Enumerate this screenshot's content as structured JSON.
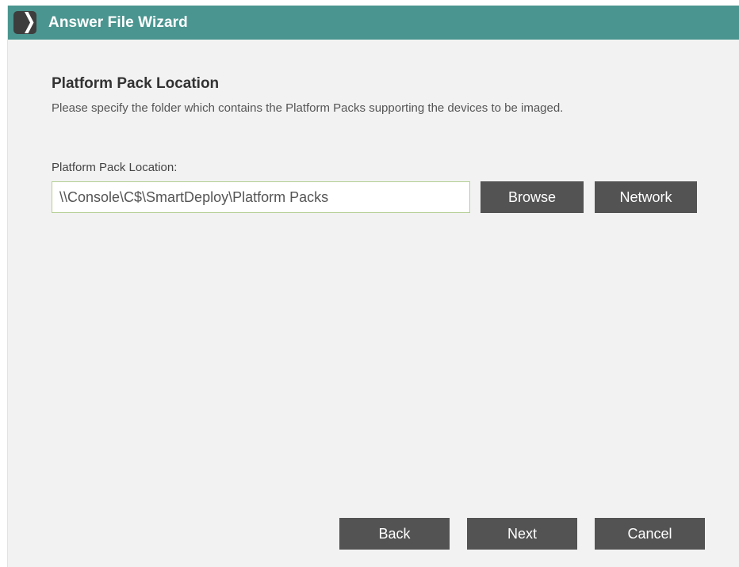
{
  "window": {
    "title": "Answer File Wizard",
    "logo_icon": "smartdeploy-chevron-icon",
    "accent_color": "#4a9590"
  },
  "section": {
    "title": "Platform Pack Location",
    "description": "Please specify the folder which contains the Platform Packs supporting the devices to be imaged."
  },
  "form": {
    "location_label": "Platform Pack Location:",
    "location_value": "\\\\Console\\C$\\SmartDeploy\\Platform Packs",
    "browse_label": "Browse",
    "network_label": "Network"
  },
  "footer": {
    "back_label": "Back",
    "next_label": "Next",
    "cancel_label": "Cancel",
    "button_color": "#535353"
  }
}
